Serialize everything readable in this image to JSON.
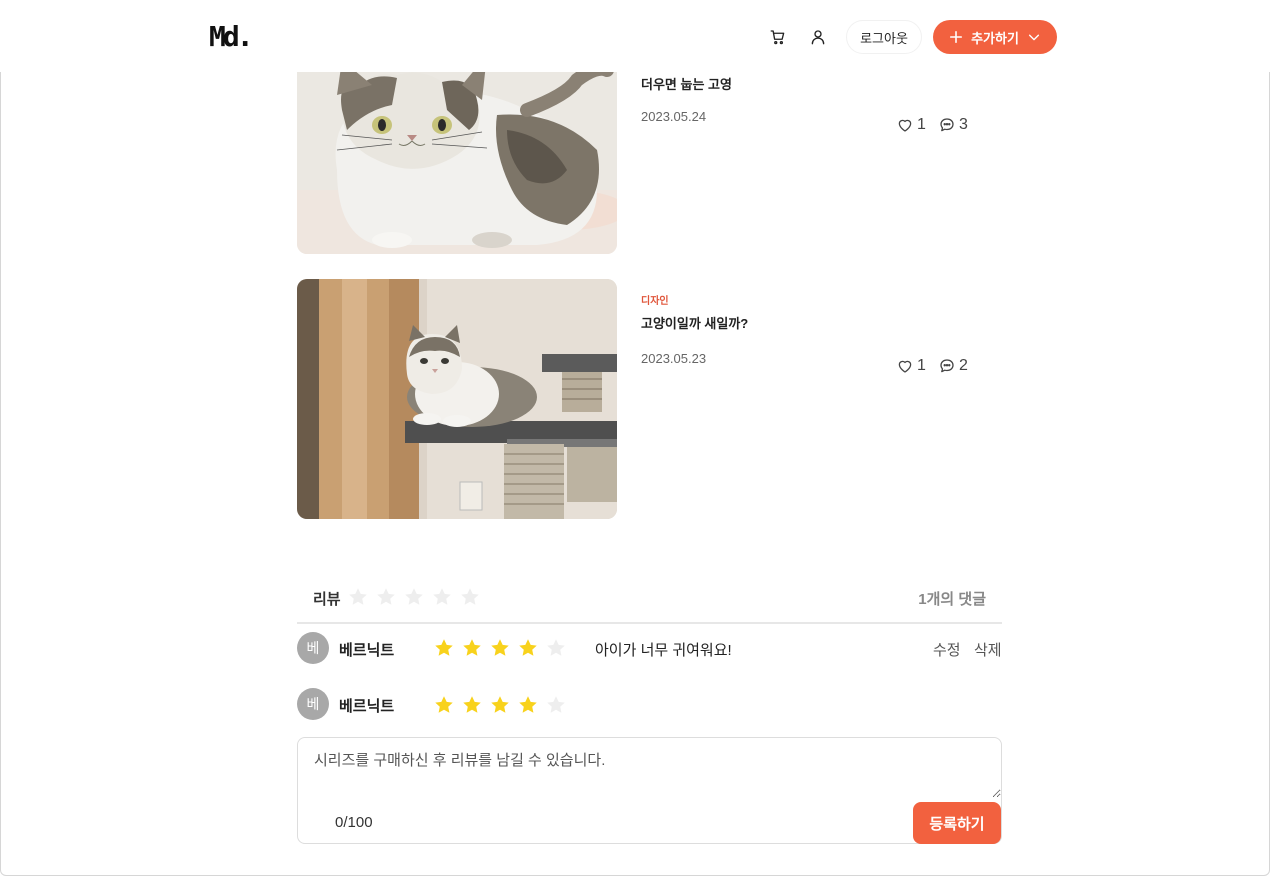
{
  "header": {
    "logo": "Md.",
    "cart_icon": "cart-icon",
    "user_icon": "user-icon",
    "logout_label": "로그아웃",
    "add_label": "추가하기",
    "colors": {
      "accent": "#f2613f"
    }
  },
  "posts": [
    {
      "category": "",
      "title": "더우면 눕는 고영",
      "date": "2023.05.24",
      "likes": "1",
      "comments": "3",
      "image": "watercolor-cat-illustration"
    },
    {
      "category": "디자인",
      "title": "고양이일까 새일까?",
      "date": "2023.05.23",
      "likes": "1",
      "comments": "2",
      "image": "cat-on-cat-tower-photo"
    }
  ],
  "review": {
    "label": "리뷰",
    "average_rating": 0,
    "count_text": "1개의 댓글",
    "items": [
      {
        "avatar": "베",
        "author": "베르닉트",
        "rating": 4,
        "text": "아이가 너무 귀여워요!",
        "edit_label": "수정",
        "delete_label": "삭제"
      }
    ],
    "composer": {
      "avatar": "베",
      "author": "베르닉트",
      "rating": 4,
      "placeholder": "시리즈를 구매하신 후 리뷰를 남길 수 있습니다.",
      "char_count": "0/100",
      "submit_label": "등록하기"
    },
    "colors": {
      "star_filled": "#f8d21c",
      "star_empty": "#eeeeee"
    }
  }
}
